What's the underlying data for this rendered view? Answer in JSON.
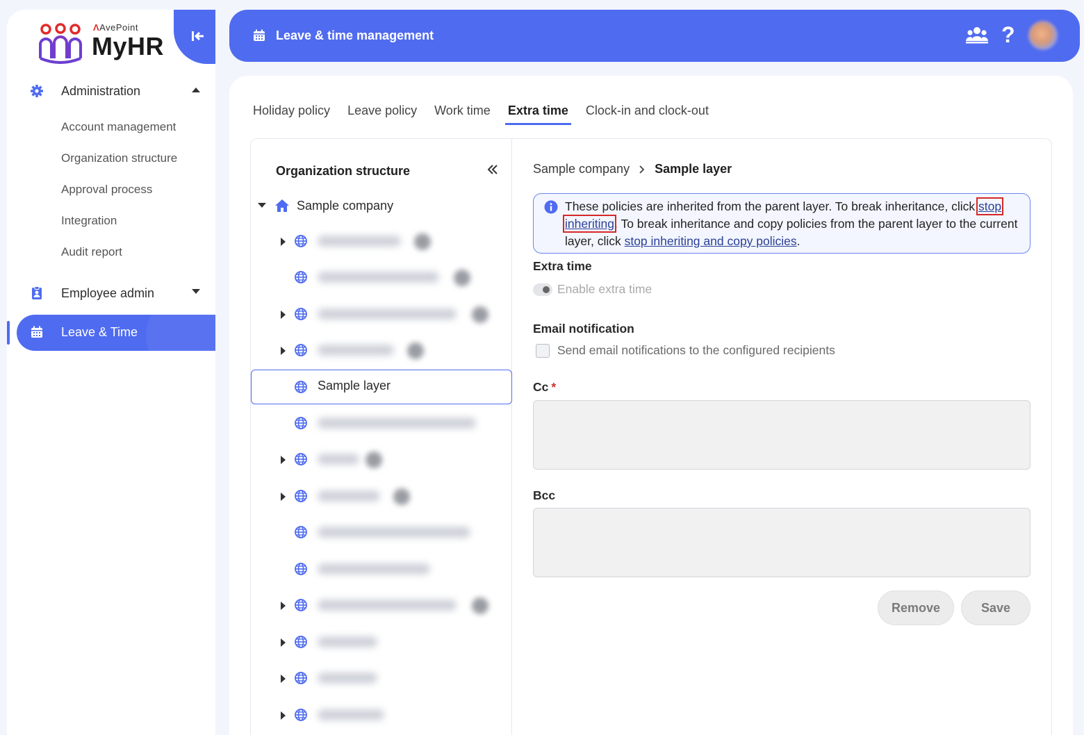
{
  "app": {
    "brand_small": "AvePoint",
    "brand_name": "MyHR",
    "colors": {
      "accent": "#4f6bf0",
      "logo_red": "#e02b2b",
      "logo_purple": "#6b3fd0"
    }
  },
  "sidebar": {
    "sections": [
      {
        "label": "Administration",
        "icon": "gear-icon",
        "expanded": true
      },
      {
        "label": "Employee admin",
        "icon": "badge-icon",
        "expanded": false
      }
    ],
    "admin_items": [
      "Account management",
      "Organization structure",
      "Approval process",
      "Integration",
      "Audit report"
    ],
    "active_item": {
      "label": "Leave & Time",
      "icon": "calendar-icon"
    }
  },
  "header": {
    "title": "Leave & time management",
    "icons": [
      "calendar-icon",
      "users-icon",
      "help-icon",
      "avatar"
    ]
  },
  "tabs": [
    {
      "label": "Holiday policy",
      "active": false
    },
    {
      "label": "Leave policy",
      "active": false
    },
    {
      "label": "Work time",
      "active": false
    },
    {
      "label": "Extra time",
      "active": true
    },
    {
      "label": "Clock-in and clock-out",
      "active": false
    }
  ],
  "tree": {
    "title": "Organization structure",
    "root": "Sample company",
    "selected_label": "Sample layer"
  },
  "detail": {
    "breadcrumb": {
      "parent": "Sample company",
      "current": "Sample layer"
    },
    "info": {
      "text1": "These policies are inherited from the parent layer. To break inheritance, click ",
      "link1": "stop inheriting",
      "text2": ". To break inheritance and copy policies from the parent layer to the current layer, click ",
      "link2": "stop inheriting and copy policies",
      "text3": "."
    },
    "extra_time_label": "Extra time",
    "enable_toggle_label": "Enable extra time",
    "email_label": "Email notification",
    "email_checkbox_label": "Send email notifications to the configured recipients",
    "cc_label": "Cc",
    "cc_required": "*",
    "bcc_label": "Bcc",
    "remove_label": "Remove",
    "save_label": "Save"
  }
}
